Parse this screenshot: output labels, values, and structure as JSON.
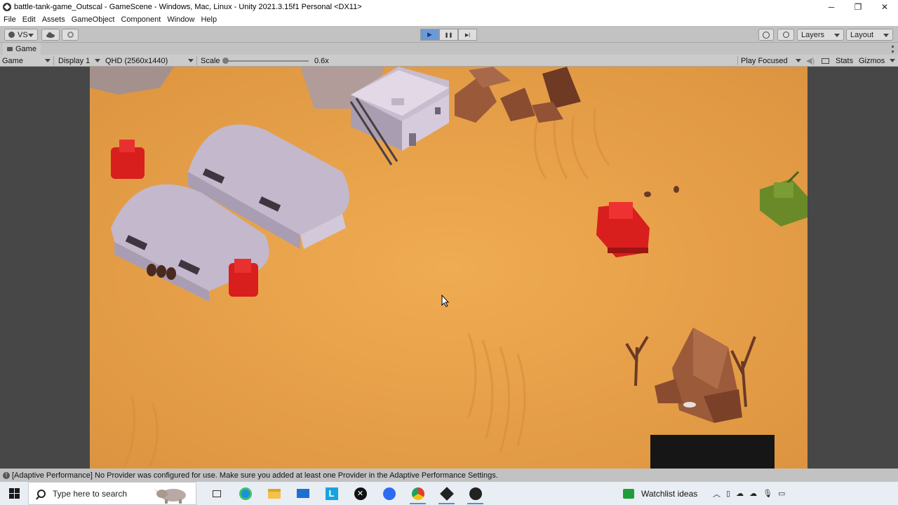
{
  "window": {
    "title": "battle-tank-game_Outscal - GameScene - Windows, Mac, Linux - Unity 2021.3.15f1 Personal <DX11>",
    "minimize": "─",
    "restore": "❐",
    "close": "✕"
  },
  "menu": {
    "items": [
      "File",
      "Edit",
      "Assets",
      "GameObject",
      "Component",
      "Window",
      "Help"
    ]
  },
  "toolbar": {
    "account_label": "VS",
    "layers_label": "Layers",
    "layout_label": "Layout",
    "play_icon": "▶",
    "pause_icon": "❚❚",
    "step_icon": "▶|"
  },
  "tab": {
    "label": "Game"
  },
  "gamebar": {
    "view_label": "Game",
    "display_label": "Display 1",
    "resolution_label": "QHD (2560x1440)",
    "scale_label": "Scale",
    "scale_value": "0.6x",
    "scale_fraction": 0.0,
    "play_mode_label": "Play Focused",
    "stats_label": "Stats",
    "gizmos_label": "Gizmos"
  },
  "status": {
    "message": "[Adaptive Performance] No Provider was configured for use. Make sure you added at least one Provider in the Adaptive Performance Settings."
  },
  "taskbar": {
    "search_placeholder": "Type here to search",
    "watchlist_label": "Watchlist ideas",
    "apps": [
      "task-view",
      "edge",
      "file-explorer",
      "mail",
      "l-app",
      "xbox",
      "zoom",
      "chrome",
      "unity",
      "obs"
    ]
  },
  "colors": {
    "sand": "#e8a548",
    "tank_enemy": "#d91e1e",
    "tank_player": "#6a8a2a",
    "building": "#b9acc3",
    "rock": "#9b5a3a"
  }
}
